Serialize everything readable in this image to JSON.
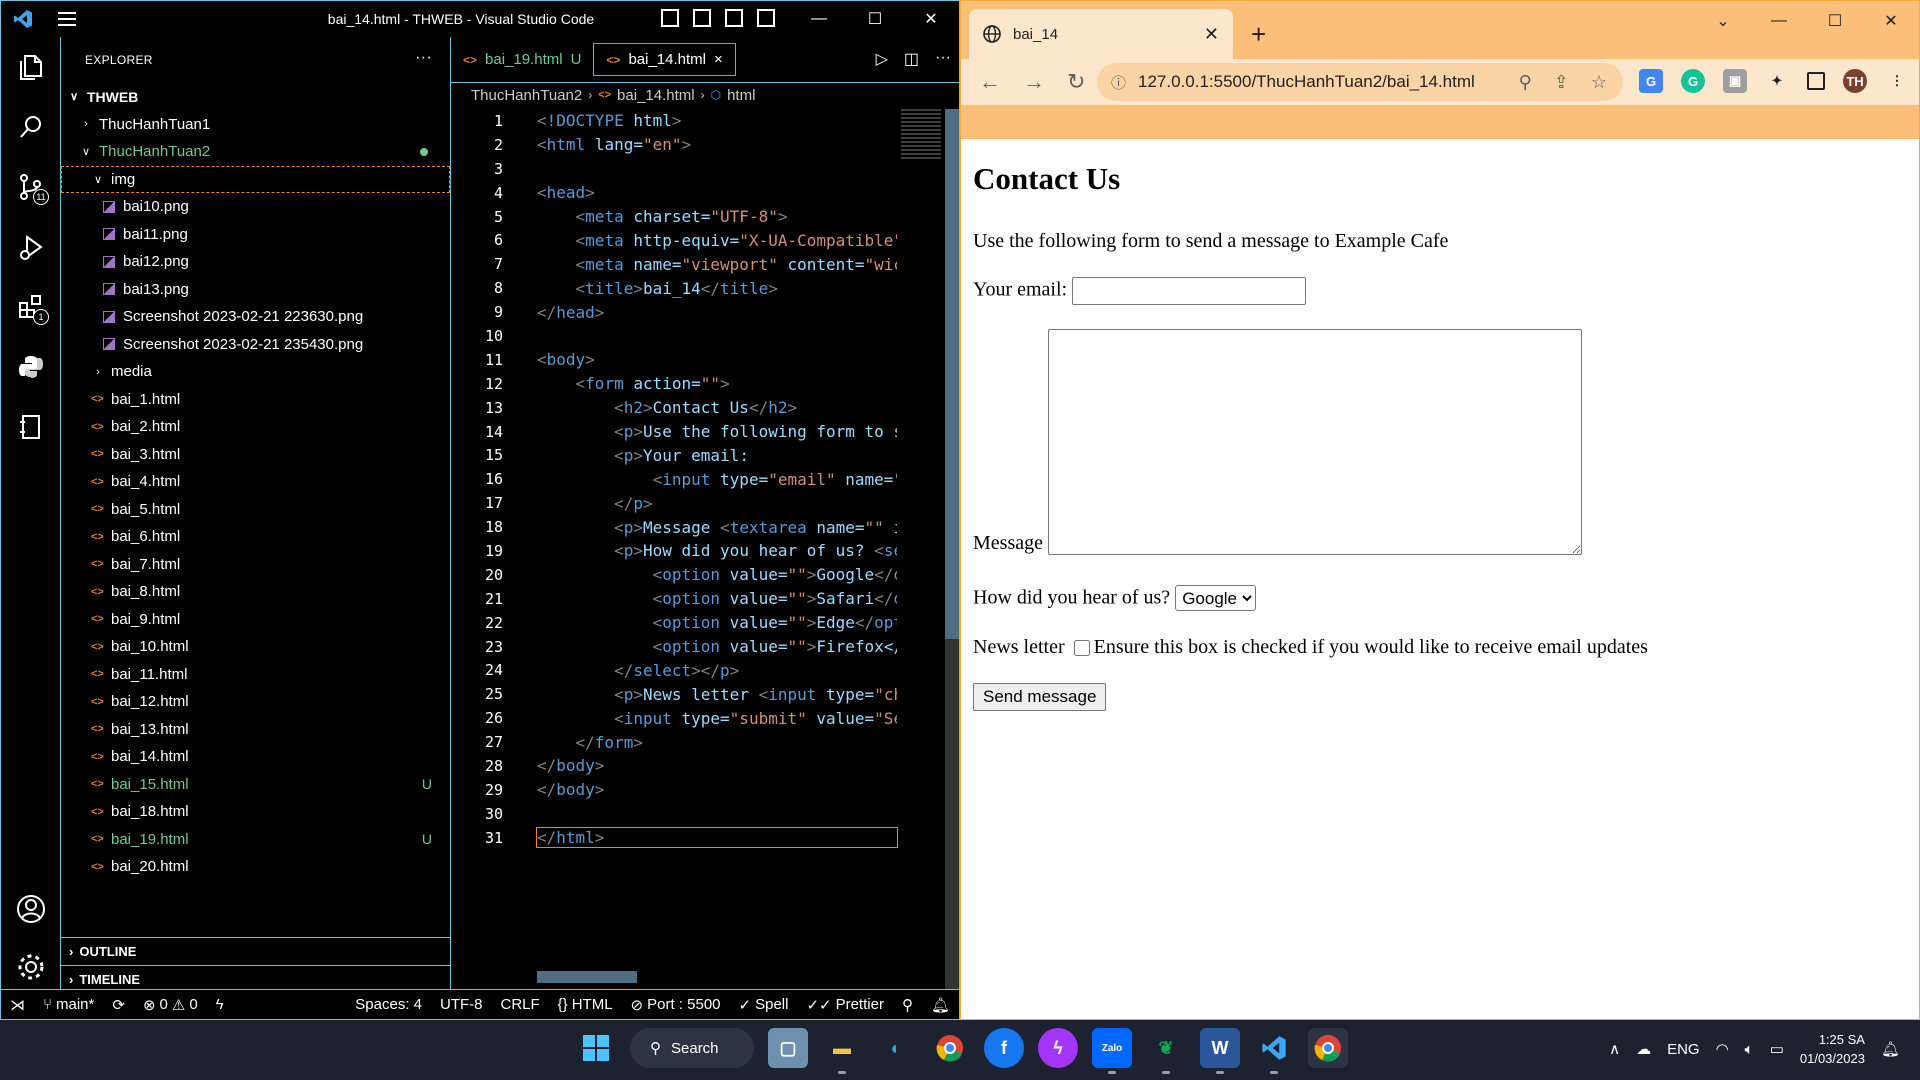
{
  "vscode": {
    "window_title": "bai_14.html - THWEB - Visual Studio Code",
    "explorer_title": "EXPLORER",
    "workspace": "THWEB",
    "tree": [
      {
        "label": "ThucHanhTuan1",
        "kind": "folder",
        "expanded": false,
        "indent": 0
      },
      {
        "label": "ThucHanhTuan2",
        "kind": "folder",
        "expanded": true,
        "indent": 0,
        "status": "dot",
        "green": true
      },
      {
        "label": "img",
        "kind": "folder",
        "expanded": true,
        "indent": 1,
        "focused": true
      },
      {
        "label": "bai10.png",
        "kind": "image",
        "indent": 2
      },
      {
        "label": "bai11.png",
        "kind": "image",
        "indent": 2
      },
      {
        "label": "bai12.png",
        "kind": "image",
        "indent": 2
      },
      {
        "label": "bai13.png",
        "kind": "image",
        "indent": 2
      },
      {
        "label": "Screenshot 2023-02-21 223630.png",
        "kind": "image",
        "indent": 2
      },
      {
        "label": "Screenshot 2023-02-21 235430.png",
        "kind": "image",
        "indent": 2
      },
      {
        "label": "media",
        "kind": "folder",
        "expanded": false,
        "indent": 1
      },
      {
        "label": "bai_1.html",
        "kind": "html",
        "indent": 1
      },
      {
        "label": "bai_2.html",
        "kind": "html",
        "indent": 1
      },
      {
        "label": "bai_3.html",
        "kind": "html",
        "indent": 1
      },
      {
        "label": "bai_4.html",
        "kind": "html",
        "indent": 1
      },
      {
        "label": "bai_5.html",
        "kind": "html",
        "indent": 1
      },
      {
        "label": "bai_6.html",
        "kind": "html",
        "indent": 1
      },
      {
        "label": "bai_7.html",
        "kind": "html",
        "indent": 1
      },
      {
        "label": "bai_8.html",
        "kind": "html",
        "indent": 1
      },
      {
        "label": "bai_9.html",
        "kind": "html",
        "indent": 1
      },
      {
        "label": "bai_10.html",
        "kind": "html",
        "indent": 1
      },
      {
        "label": "bai_11.html",
        "kind": "html",
        "indent": 1
      },
      {
        "label": "bai_12.html",
        "kind": "html",
        "indent": 1
      },
      {
        "label": "bai_13.html",
        "kind": "html",
        "indent": 1
      },
      {
        "label": "bai_14.html",
        "kind": "html",
        "indent": 1
      },
      {
        "label": "bai_15.html",
        "kind": "html",
        "indent": 1,
        "status": "U",
        "green": true
      },
      {
        "label": "bai_18.html",
        "kind": "html",
        "indent": 1
      },
      {
        "label": "bai_19.html",
        "kind": "html",
        "indent": 1,
        "status": "U",
        "green": true
      },
      {
        "label": "bai_20.html",
        "kind": "html",
        "indent": 1
      }
    ],
    "outline_label": "OUTLINE",
    "timeline_label": "TIMELINE",
    "tabs": [
      {
        "label": "bai_19.html",
        "status": "U",
        "active": false
      },
      {
        "label": "bai_14.html",
        "status": "×",
        "active": true
      }
    ],
    "breadcrumb": [
      "ThucHanhTuan2",
      "bai_14.html",
      "html"
    ],
    "code_lines": [
      "<!DOCTYPE html>",
      "<html lang=\"en\">",
      "",
      "<head>",
      "    <meta charset=\"UTF-8\">",
      "    <meta http-equiv=\"X-UA-Compatible\"",
      "    <meta name=\"viewport\" content=\"wic",
      "    <title>bai_14</title>",
      "</head>",
      "",
      "<body>",
      "    <form action=\"\">",
      "        <h2>Contact Us</h2>",
      "        <p>Use the following form to s",
      "        <p>Your email:",
      "            <input type=\"email\" name=\"",
      "        </p>",
      "        <p>Message <textarea name=\"\" i",
      "        <p>How did you hear of us? <se",
      "            <option value=\"\">Google</o",
      "            <option value=\"\">Safari</o",
      "            <option value=\"\">Edge</opt",
      "            <option value=\"\">Firefox</",
      "        </select></p>",
      "        <p>News letter <input type=\"ch",
      "        <input type=\"submit\" value=\"Se",
      "    </form>",
      "</body>",
      "</body>",
      "",
      "</html>"
    ],
    "current_line": 31,
    "status": {
      "branch": "main*",
      "errors": "0",
      "warnings": "0",
      "spaces": "Spaces: 4",
      "encoding": "UTF-8",
      "eol": "CRLF",
      "language": "HTML",
      "port": "Port : 5500",
      "spell": "Spell",
      "prettier": "Prettier"
    }
  },
  "chrome": {
    "tab_title": "bai_14",
    "url": "127.0.0.1:5500/ThucHanhTuan2/bai_14.html",
    "page": {
      "heading": "Contact Us",
      "intro": "Use the following form to send a message to Example Cafe",
      "email_label": "Your email:",
      "message_label": "Message",
      "hear_label": "How did you hear of us?",
      "select_value": "Google",
      "newsletter_label": "News letter",
      "checkbox_label": "Ensure this box is checked if you would like to receive email updates",
      "submit_label": "Send message"
    }
  },
  "taskbar": {
    "search_label": "Search",
    "lang": "ENG",
    "time": "1:25 SA",
    "date": "01/03/2023"
  }
}
